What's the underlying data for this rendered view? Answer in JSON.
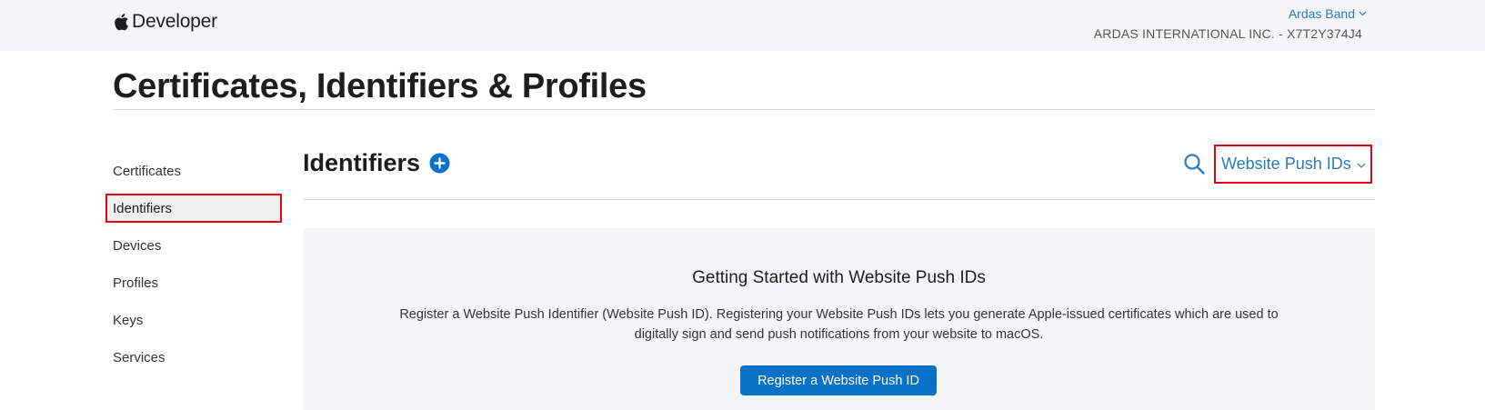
{
  "header": {
    "brand_text": "Developer",
    "account_name": "Ardas Band",
    "team_name": "ARDAS INTERNATIONAL INC. - X7T2Y374J4"
  },
  "page_title": "Certificates, Identifiers & Profiles",
  "sidebar": {
    "items": [
      {
        "label": "Certificates",
        "active": false
      },
      {
        "label": "Identifiers",
        "active": true
      },
      {
        "label": "Devices",
        "active": false
      },
      {
        "label": "Profiles",
        "active": false
      },
      {
        "label": "Keys",
        "active": false
      },
      {
        "label": "Services",
        "active": false
      }
    ]
  },
  "main": {
    "section_title": "Identifiers",
    "filter_selected": "Website Push IDs",
    "empty_state": {
      "title": "Getting Started with Website Push IDs",
      "description": "Register a Website Push Identifier (Website Push ID). Registering your Website Push IDs lets you generate Apple-issued certificates which are used to digitally sign and send push notifications from your website to macOS.",
      "button_label": "Register a Website Push ID"
    }
  },
  "colors": {
    "link_blue": "#2a7bc0",
    "button_blue": "#0a71c9",
    "highlight_red": "#e60012",
    "header_bg": "#f5f5f7"
  },
  "icons": {
    "brand": "apple-logo-icon",
    "add": "plus-circle-icon",
    "search": "search-icon",
    "dropdown": "chevron-down-icon"
  }
}
